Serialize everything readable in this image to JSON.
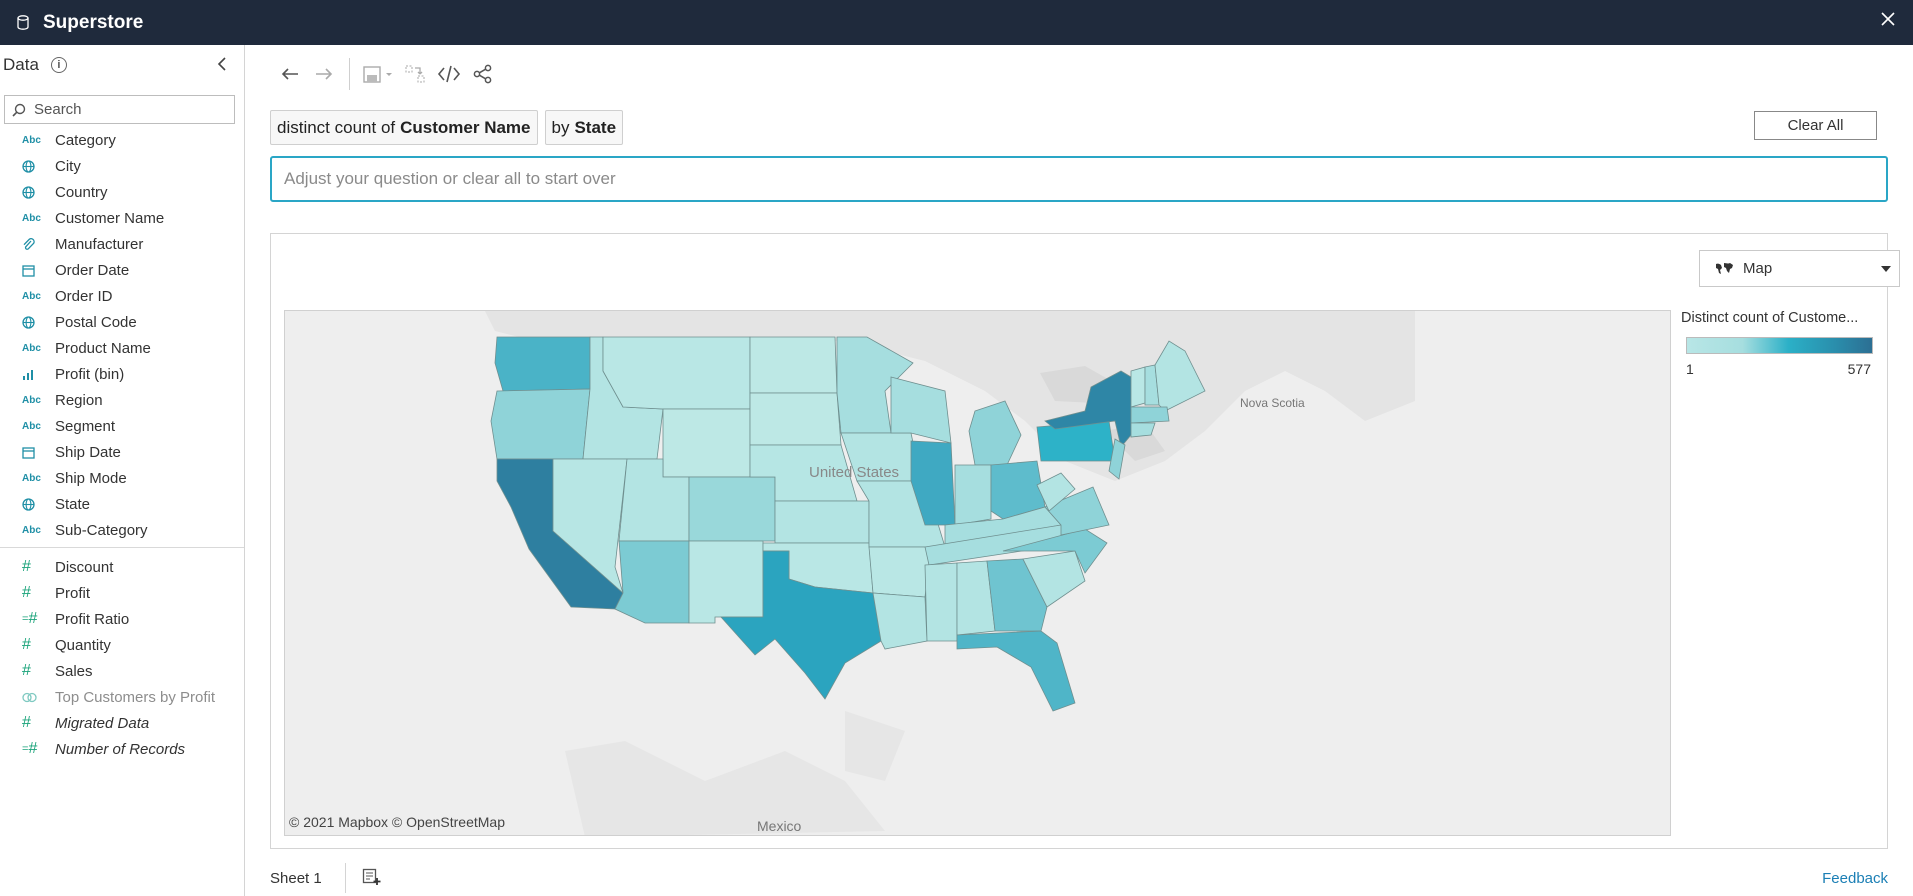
{
  "app": {
    "title": "Superstore"
  },
  "sidebar": {
    "title": "Data",
    "search_placeholder": "Search",
    "dimensions": [
      {
        "icon": "Abc",
        "icon_name": "string-icon",
        "label": "Category"
      },
      {
        "icon": "geo",
        "icon_name": "globe-icon",
        "label": "City"
      },
      {
        "icon": "geo",
        "icon_name": "globe-icon",
        "label": "Country"
      },
      {
        "icon": "Abc",
        "icon_name": "string-icon",
        "label": "Customer Name"
      },
      {
        "icon": "link",
        "icon_name": "paperclip-icon",
        "label": "Manufacturer"
      },
      {
        "icon": "date",
        "icon_name": "calendar-icon",
        "label": "Order Date"
      },
      {
        "icon": "Abc",
        "icon_name": "string-icon",
        "label": "Order ID"
      },
      {
        "icon": "geo",
        "icon_name": "globe-icon",
        "label": "Postal Code"
      },
      {
        "icon": "Abc",
        "icon_name": "string-icon",
        "label": "Product Name"
      },
      {
        "icon": "bin",
        "icon_name": "bin-icon",
        "label": "Profit (bin)"
      },
      {
        "icon": "Abc",
        "icon_name": "string-icon",
        "label": "Region"
      },
      {
        "icon": "Abc",
        "icon_name": "string-icon",
        "label": "Segment"
      },
      {
        "icon": "date",
        "icon_name": "calendar-icon",
        "label": "Ship Date"
      },
      {
        "icon": "Abc",
        "icon_name": "string-icon",
        "label": "Ship Mode"
      },
      {
        "icon": "geo",
        "icon_name": "globe-icon",
        "label": "State"
      },
      {
        "icon": "Abc",
        "icon_name": "string-icon",
        "label": "Sub-Category"
      }
    ],
    "measures": [
      {
        "icon": "#",
        "icon_name": "number-icon",
        "label": "Discount",
        "style": ""
      },
      {
        "icon": "#",
        "icon_name": "number-icon",
        "label": "Profit",
        "style": ""
      },
      {
        "icon": "=#",
        "icon_name": "calculated-number-icon",
        "label": "Profit Ratio",
        "style": ""
      },
      {
        "icon": "#",
        "icon_name": "number-icon",
        "label": "Quantity",
        "style": ""
      },
      {
        "icon": "#",
        "icon_name": "number-icon",
        "label": "Sales",
        "style": ""
      },
      {
        "icon": "set",
        "icon_name": "set-icon",
        "label": "Top Customers by Profit",
        "style": "muted"
      },
      {
        "icon": "#",
        "icon_name": "number-icon",
        "label": "Migrated Data",
        "style": "italic"
      },
      {
        "icon": "=#",
        "icon_name": "calculated-number-icon",
        "label": "Number of Records",
        "style": "italic"
      }
    ]
  },
  "query": {
    "pill1_prefix": "distinct count of",
    "pill1_field": "Customer Name",
    "pill2_prefix": "by",
    "pill2_field": "State",
    "clear_all": "Clear All",
    "input_placeholder": "Adjust your question or clear all to start over"
  },
  "viz": {
    "type_label": "Map",
    "attribution": "© 2021 Mapbox  © OpenStreetMap",
    "legend": {
      "title": "Distinct count of Custome...",
      "min": "1",
      "max": "577"
    },
    "basemap_labels": {
      "country": "United States",
      "mexico": "Mexico",
      "nova_scotia": "Nova Scotia"
    }
  },
  "chart_data": {
    "type": "choropleth",
    "measure": "Distinct count of Customer Name",
    "dimension": "State",
    "range": [
      1,
      577
    ],
    "regions": [
      {
        "state": "California",
        "level": "very high"
      },
      {
        "state": "New York",
        "level": "very high"
      },
      {
        "state": "Texas",
        "level": "high"
      },
      {
        "state": "Pennsylvania",
        "level": "high"
      },
      {
        "state": "Washington",
        "level": "medium-high"
      },
      {
        "state": "Illinois",
        "level": "medium-high"
      },
      {
        "state": "Ohio",
        "level": "medium"
      },
      {
        "state": "Florida",
        "level": "medium"
      }
    ]
  },
  "footer": {
    "sheet": "Sheet 1",
    "feedback": "Feedback"
  }
}
